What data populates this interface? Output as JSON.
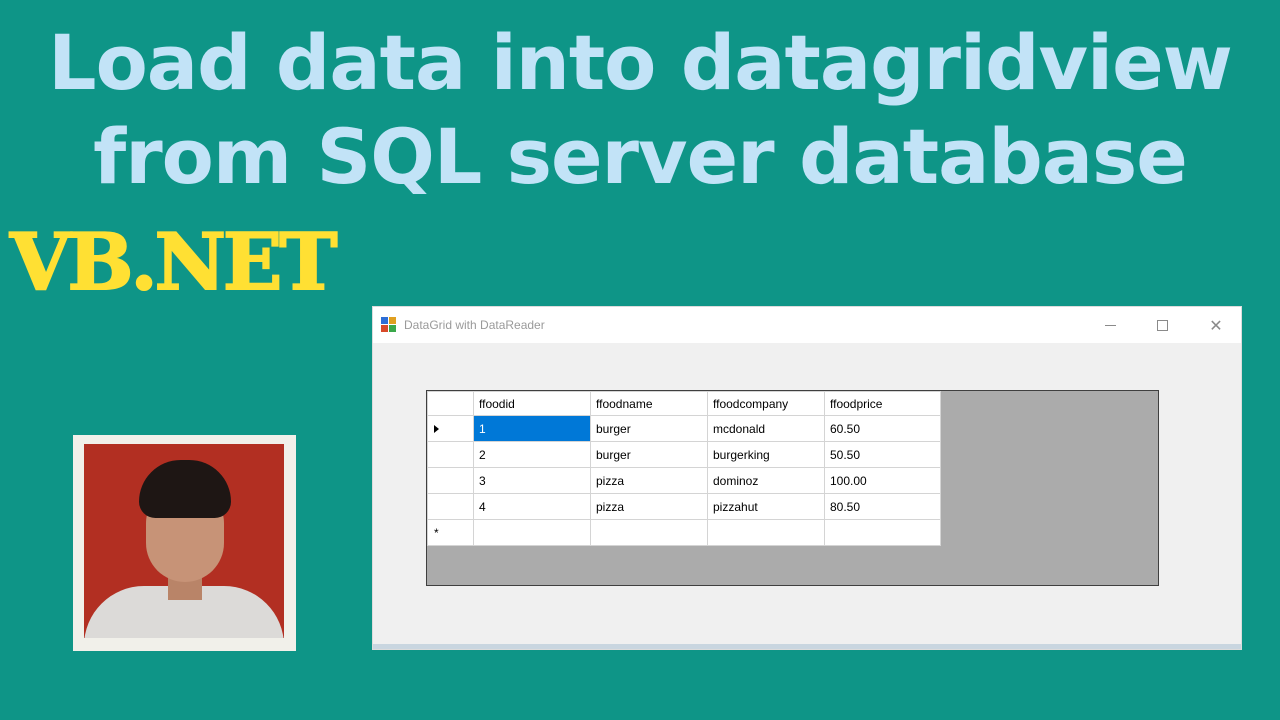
{
  "headline": {
    "line1": "Load data into datagridview",
    "line2": "from SQL server database",
    "tagline": "VB.NET"
  },
  "window": {
    "title": "DataGrid with DataReader",
    "controls": {
      "minimize_icon": "minimize-icon",
      "maximize_icon": "maximize-icon",
      "close_glyph": "✕"
    }
  },
  "grid": {
    "columns": [
      "ffoodid",
      "ffoodname",
      "ffoodcompany",
      "ffoodprice"
    ],
    "rows": [
      [
        "1",
        "burger",
        "mcdonald",
        "60.50"
      ],
      [
        "2",
        "burger",
        "burgerking",
        "50.50"
      ],
      [
        "3",
        "pizza",
        "dominoz",
        "100.00"
      ],
      [
        "4",
        "pizza",
        "pizzahut",
        "80.50"
      ]
    ],
    "new_row_marker": "*"
  },
  "colors": {
    "background": "#0e9587",
    "headline": "#c2e3f7",
    "tagline": "#ffe033",
    "selection": "#0078d7"
  }
}
